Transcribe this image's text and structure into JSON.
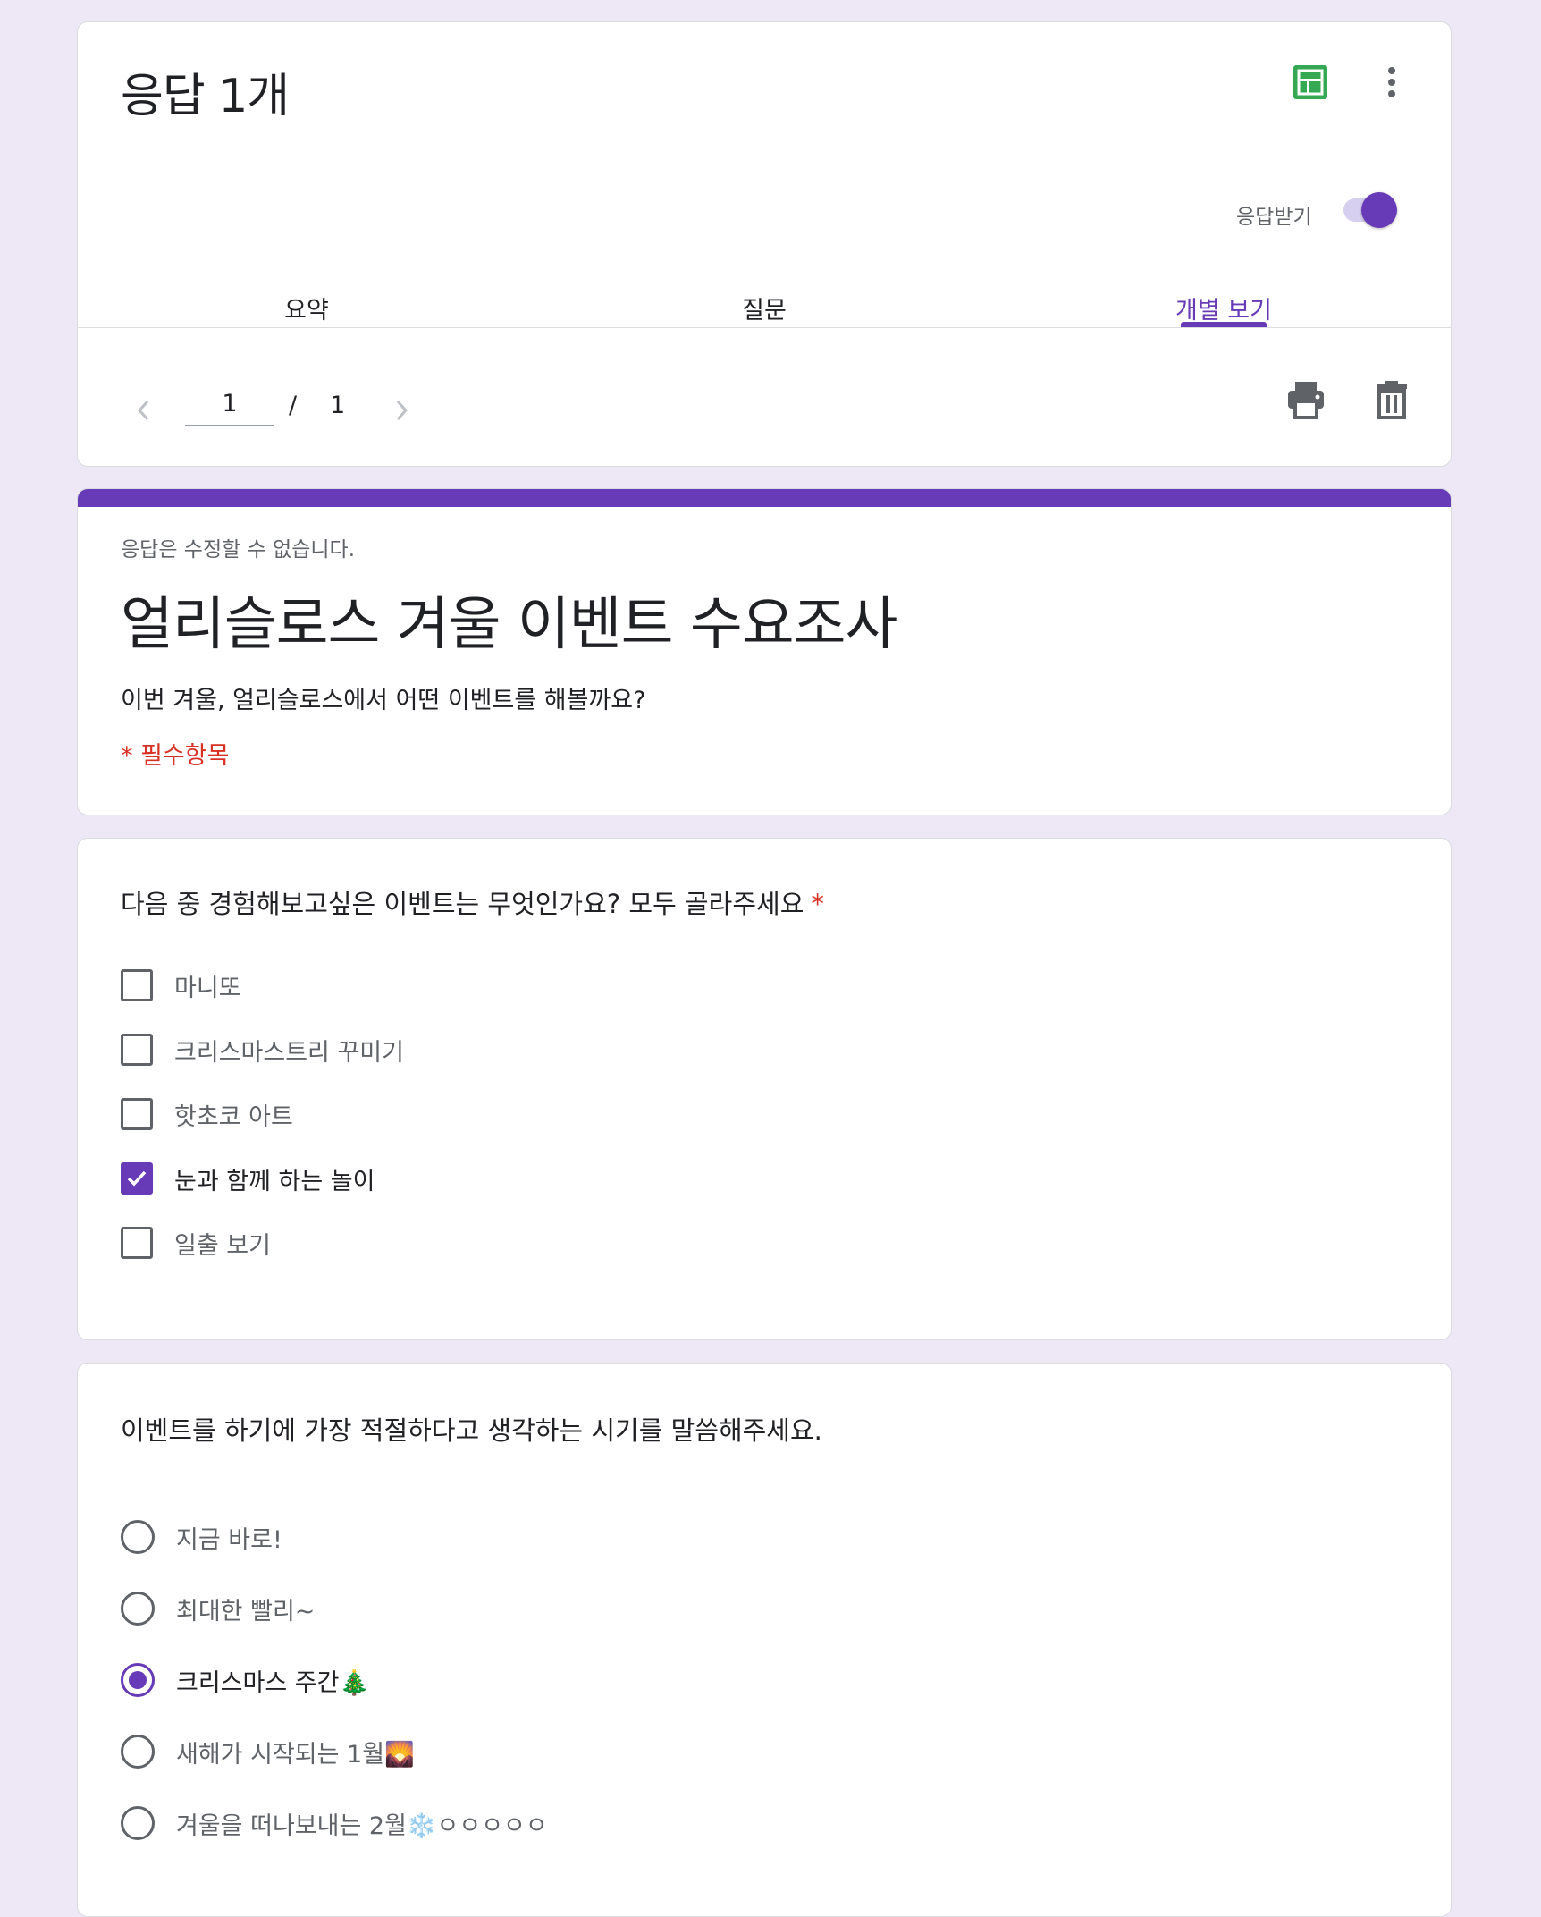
{
  "header": {
    "title": "응답 1개",
    "accepting_label": "응답받기",
    "accepting_on": true,
    "tabs": [
      {
        "label": "요약",
        "active": false
      },
      {
        "label": "질문",
        "active": false
      },
      {
        "label": "개별 보기",
        "active": true
      }
    ],
    "pager": {
      "current": "1",
      "separator": "/",
      "total": "1"
    },
    "icons": [
      "sheets-icon",
      "more-vert-icon",
      "chevron-left-icon",
      "chevron-right-icon",
      "print-icon",
      "trash-icon"
    ]
  },
  "form": {
    "notice": "응답은 수정할 수 없습니다.",
    "title": "얼리슬로스 겨울 이벤트 수요조사",
    "description": "이번 겨울, 얼리슬로스에서 어떤 이벤트를 해볼까요?",
    "required_note": "* 필수항목"
  },
  "questions": [
    {
      "title": "다음 중 경험해보고싶은 이벤트는 무엇인가요? 모두 골라주세요",
      "required_mark": "*",
      "type": "checkbox",
      "options": [
        {
          "label": "마니또",
          "checked": false
        },
        {
          "label": "크리스마스트리 꾸미기",
          "checked": false
        },
        {
          "label": "핫초코 아트",
          "checked": false
        },
        {
          "label": "눈과 함께 하는 놀이",
          "checked": true
        },
        {
          "label": "일출 보기",
          "checked": false
        }
      ]
    },
    {
      "title": "이벤트를 하기에 가장 적절하다고 생각하는 시기를 말씀해주세요.",
      "type": "radio",
      "options": [
        {
          "label": "지금 바로!",
          "checked": false
        },
        {
          "label": "최대한 빨리~",
          "checked": false
        },
        {
          "label": "크리스마스 주간🎄",
          "checked": true
        },
        {
          "label": "새해가 시작되는 1월🌄",
          "checked": false
        },
        {
          "label": "겨울을 떠나보내는 2월❄️ㅇㅇㅇㅇㅇ",
          "checked": false
        }
      ]
    }
  ],
  "colors": {
    "accent": "#673ab7",
    "background": "#ede7f6",
    "required": "#d93025",
    "sheets_green": "#34a853"
  }
}
